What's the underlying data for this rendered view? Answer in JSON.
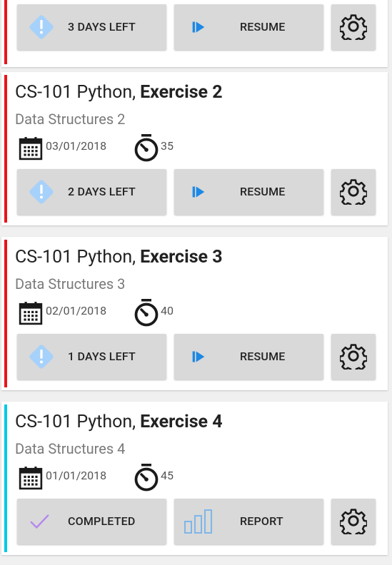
{
  "colors": {
    "active_accent": "#e8141c",
    "completed_accent": "#00c9e6",
    "diamond": "#a6d1fa",
    "resume": "#1e88e5",
    "check": "#b487ee",
    "report": "#7fb6e8"
  },
  "icons": {
    "due": "diamond-exclamation-icon",
    "resume": "play-resume-icon",
    "settings": "gear-icon",
    "date": "calendar-icon",
    "duration": "stopwatch-icon",
    "completed": "checkmark-icon",
    "report": "bar-chart-icon"
  },
  "cards": [
    {
      "status": "active",
      "due_label": "3 DAYS LEFT",
      "resume_label": "RESUME"
    },
    {
      "status": "active",
      "course": "CS-101 Python,",
      "exercise": "Exercise 2",
      "subtitle": "Data Structures 2",
      "date": "03/01/2018",
      "duration": "35",
      "due_label": "2 DAYS LEFT",
      "resume_label": "RESUME"
    },
    {
      "status": "active",
      "course": "CS-101 Python,",
      "exercise": "Exercise 3",
      "subtitle": "Data Structures 3",
      "date": "02/01/2018",
      "duration": "40",
      "due_label": "1 DAYS LEFT",
      "resume_label": "RESUME"
    },
    {
      "status": "completed",
      "course": "CS-101 Python,",
      "exercise": "Exercise 4",
      "subtitle": "Data Structures 4",
      "date": "01/01/2018",
      "duration": "45",
      "completed_label": "COMPLETED",
      "report_label": "REPORT"
    }
  ]
}
